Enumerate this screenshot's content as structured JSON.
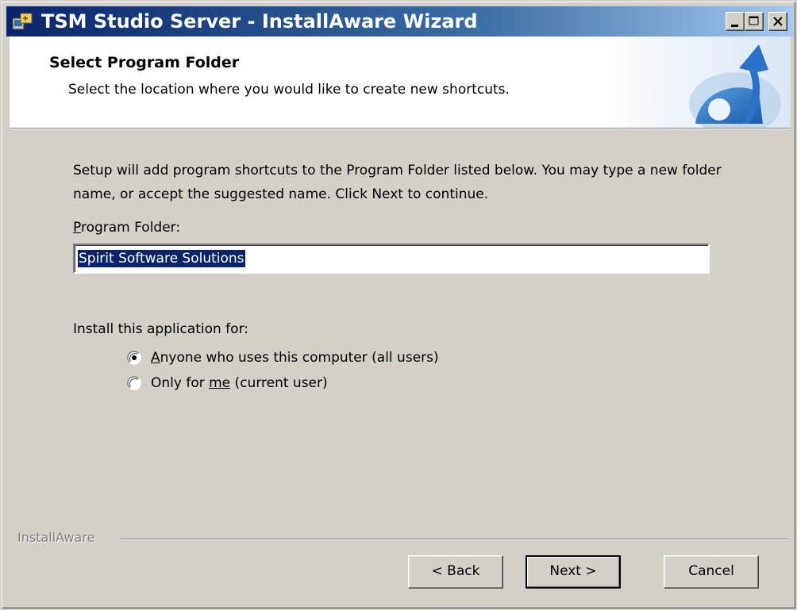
{
  "window": {
    "title": "TSM Studio Server - InstallAware Wizard"
  },
  "header": {
    "title": "Select Program Folder",
    "subtitle": "Select the location where you would like to create new shortcuts."
  },
  "body": {
    "intro": "Setup will add program shortcuts to the Program Folder listed below. You may type a new folder name, or accept the suggested name. Click Next to continue.",
    "folder_label_accel": "P",
    "folder_label_rest": "rogram Folder:",
    "folder_value": "Spirit Software Solutions",
    "install_label": "Install this application for:",
    "radio_all_accel": "A",
    "radio_all_rest": "nyone who uses this computer (all users)",
    "radio_all_selected": true,
    "radio_me_pre": "Only for ",
    "radio_me_accel": "me",
    "radio_me_post": " (current user)",
    "radio_me_selected": false
  },
  "footer": {
    "brand": "InstallAware",
    "back_label": "< Back",
    "next_label": "Next >",
    "cancel_label": "Cancel"
  },
  "colors": {
    "face": "#d4d0c8",
    "titlebar_start": "#0a246a",
    "titlebar_end": "#a6caf0",
    "selection": "#0a246a"
  }
}
